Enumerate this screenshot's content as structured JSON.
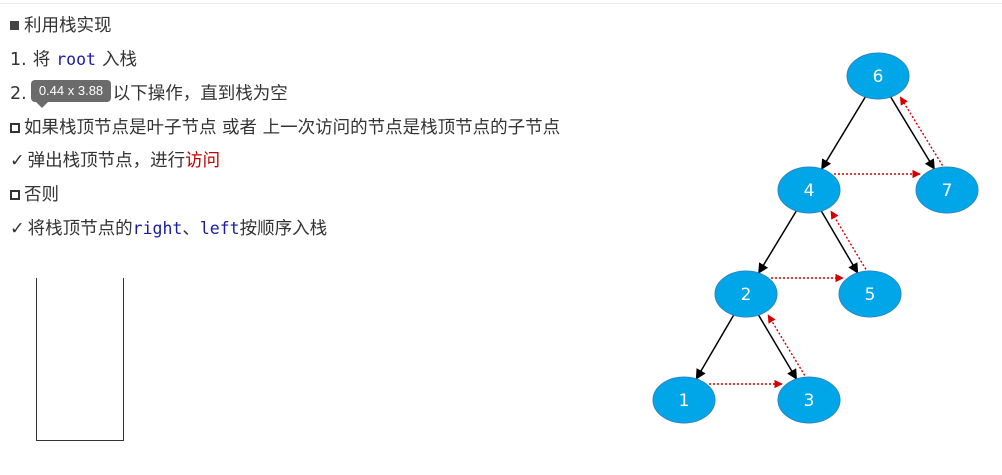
{
  "title": "利用栈实现",
  "steps": {
    "step1": {
      "prefix": "1.",
      "text_before": "将",
      "code": "root",
      "text_after": "入栈"
    },
    "step2": {
      "prefix": "2.",
      "text": "以下操作，直到栈为空"
    }
  },
  "condition_if": "如果栈顶节点是叶子节点 或者 上一次访问的节点是栈顶节点的子节点",
  "action_if": {
    "text": "弹出栈顶节点，进行",
    "accent": "访问"
  },
  "condition_else": "否则",
  "action_else": {
    "text_before": "将栈顶节点的",
    "code1": "right",
    "sep": "、",
    "code2": "left",
    "text_after": "按顺序入栈"
  },
  "tooltip": "0.44 x 3.88",
  "colors": {
    "node_fill": "#00a6e8",
    "dotted_arrow": "#d40000",
    "edge": "#000000",
    "code": "#1a1aa6",
    "accent": "#c00000"
  },
  "tree": {
    "nodes": [
      {
        "id": "6",
        "label": "6"
      },
      {
        "id": "4",
        "label": "4"
      },
      {
        "id": "7",
        "label": "7"
      },
      {
        "id": "2",
        "label": "2"
      },
      {
        "id": "5",
        "label": "5"
      },
      {
        "id": "1",
        "label": "1"
      },
      {
        "id": "3",
        "label": "3"
      }
    ],
    "edges": [
      {
        "from": "6",
        "to": "4"
      },
      {
        "from": "6",
        "to": "7"
      },
      {
        "from": "4",
        "to": "2"
      },
      {
        "from": "4",
        "to": "5"
      },
      {
        "from": "2",
        "to": "1"
      },
      {
        "from": "2",
        "to": "3"
      }
    ],
    "traversal": [
      "1",
      "3",
      "2",
      "5",
      "4",
      "7",
      "6"
    ]
  }
}
